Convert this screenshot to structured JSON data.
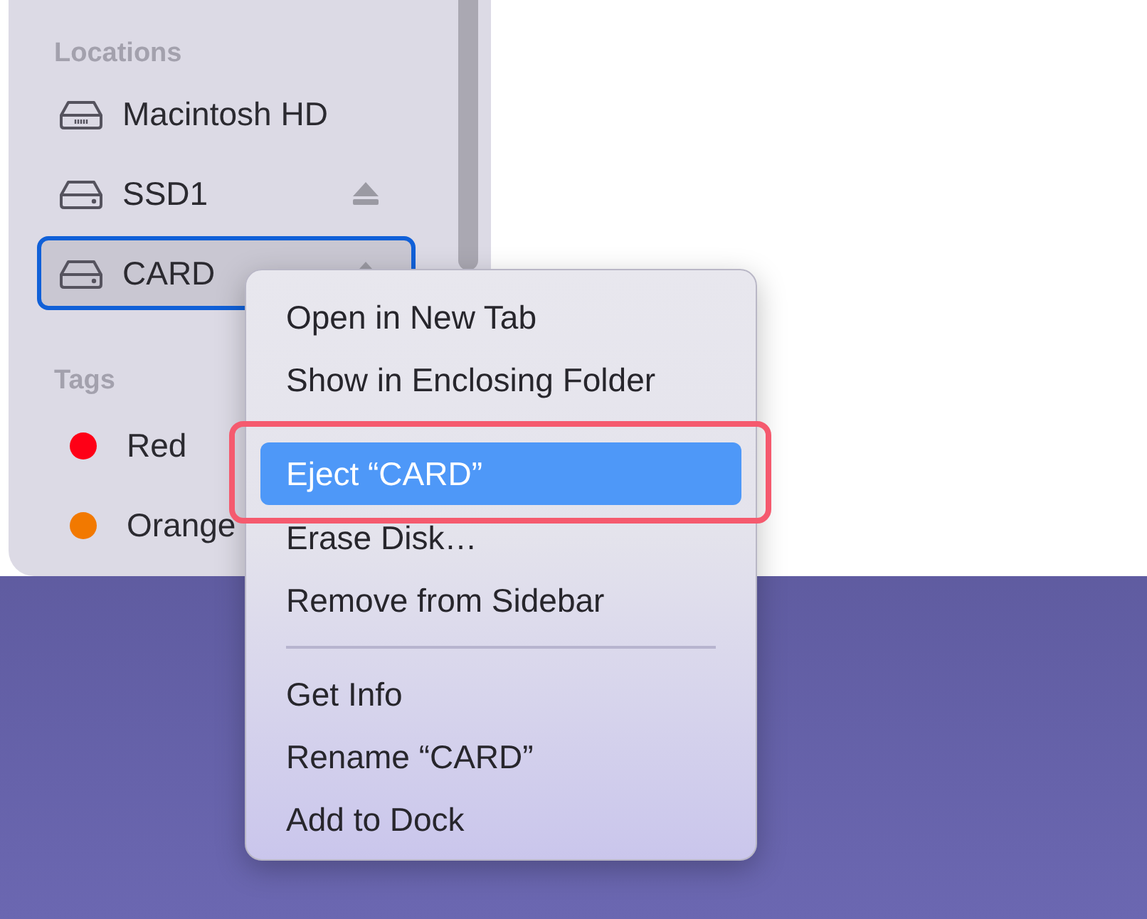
{
  "sidebar": {
    "sections": [
      {
        "title": "Locations",
        "items": [
          {
            "kind": "internal",
            "label": "Macintosh HD",
            "ejectable": false,
            "selected": false
          },
          {
            "kind": "external",
            "label": "SSD1",
            "ejectable": true,
            "selected": false
          },
          {
            "kind": "external",
            "label": "CARD",
            "ejectable": true,
            "selected": true
          }
        ]
      },
      {
        "title": "Tags",
        "items": [
          {
            "kind": "tag",
            "label": "Red",
            "color": "#fe0016"
          },
          {
            "kind": "tag",
            "label": "Orange",
            "color": "#f27900"
          }
        ]
      }
    ]
  },
  "context_menu": {
    "items": [
      {
        "kind": "item",
        "label": "Open in New Tab",
        "highlighted": false,
        "annotated": false
      },
      {
        "kind": "item",
        "label": "Show in Enclosing Folder",
        "highlighted": false,
        "annotated": false
      },
      {
        "kind": "item",
        "label": "Eject “CARD”",
        "highlighted": true,
        "annotated": true
      },
      {
        "kind": "item",
        "label": "Erase Disk…",
        "highlighted": false,
        "annotated": false
      },
      {
        "kind": "item",
        "label": "Remove from Sidebar",
        "highlighted": false,
        "annotated": false
      },
      {
        "kind": "separator"
      },
      {
        "kind": "item",
        "label": "Get Info",
        "highlighted": false,
        "annotated": false
      },
      {
        "kind": "item",
        "label": "Rename “CARD”",
        "highlighted": false,
        "annotated": false
      },
      {
        "kind": "item",
        "label": "Add to Dock",
        "highlighted": false,
        "annotated": false
      }
    ]
  }
}
